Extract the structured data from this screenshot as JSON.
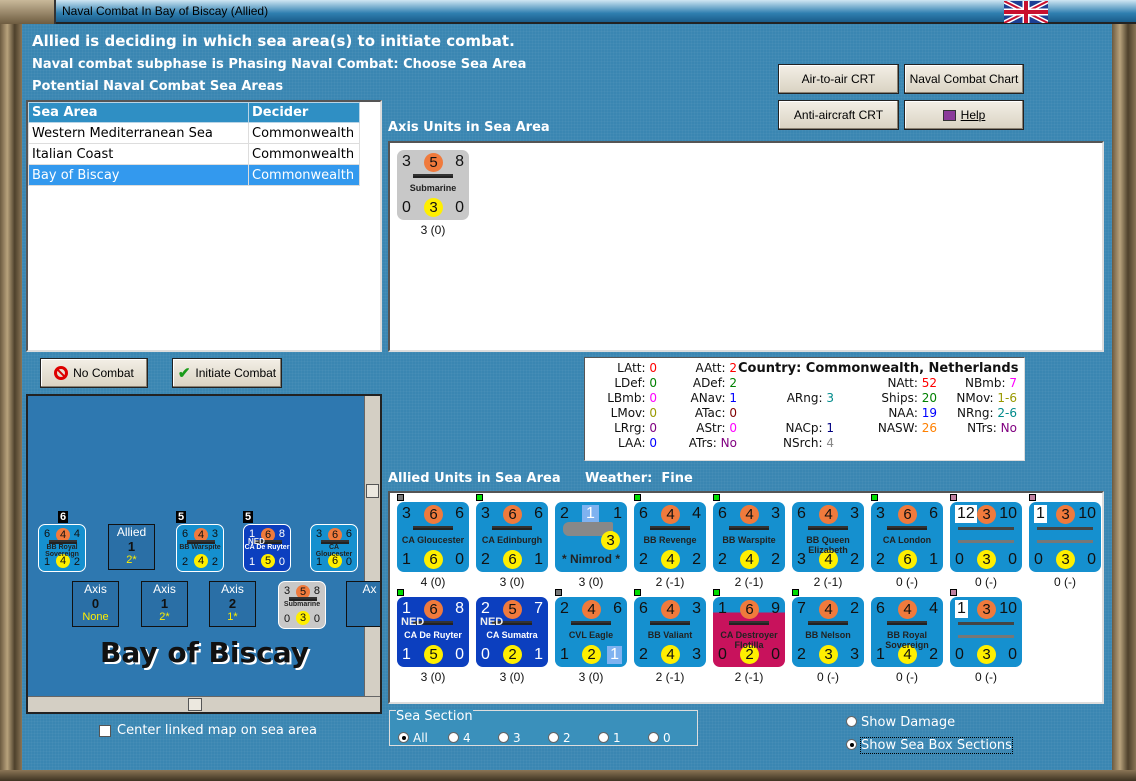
{
  "window": {
    "title": "Naval Combat In Bay of Biscay (Allied)"
  },
  "header": {
    "line1": "Allied is deciding in which sea area(s) to initiate combat.",
    "line2": "Naval combat subphase is Phasing Naval Combat: Choose Sea Area",
    "line3": "Potential Naval Combat Sea Areas"
  },
  "sea_table": {
    "columns": [
      "Sea Area",
      "Decider"
    ],
    "rows": [
      [
        "Western Mediterranean Sea",
        "Commonwealth"
      ],
      [
        "Italian Coast",
        "Commonwealth"
      ],
      [
        "Bay of Biscay",
        "Commonwealth"
      ]
    ],
    "selected": 2
  },
  "buttons": {
    "no_combat": "No Combat",
    "initiate_combat": "Initiate Combat",
    "air_to_air": "Air-to-air CRT",
    "naval_chart": "Naval Combat Chart",
    "anti_aircraft": "Anti-aircraft CRT",
    "help": "Help"
  },
  "axis": {
    "title": "Axis Units in Sea Area",
    "units": [
      {
        "tl": "3",
        "top": "5",
        "tr": "8",
        "name": "Submarine",
        "bl": "0",
        "bot": "3",
        "br": "0",
        "cap": "3 (0)",
        "style": "gray"
      }
    ]
  },
  "stats": {
    "country": "Country: Commonwealth, Netherlands",
    "items": [
      {
        "k": "LAtt:",
        "v": "0",
        "c": "#ff0000"
      },
      {
        "k": "LDef:",
        "v": "0",
        "c": "#008000"
      },
      {
        "k": "LBmb:",
        "v": "0",
        "c": "#ff00ff"
      },
      {
        "k": "LMov:",
        "v": "0",
        "c": "#999900"
      },
      {
        "k": "LRrg:",
        "v": "0",
        "c": "#800080"
      },
      {
        "k": "LAA:",
        "v": "0",
        "c": "#0000ff"
      },
      {
        "k": "AAtt:",
        "v": "2",
        "c": "#ff0000"
      },
      {
        "k": "ADef:",
        "v": "2",
        "c": "#008000"
      },
      {
        "k": "ANav:",
        "v": "1",
        "c": "#0000ff"
      },
      {
        "k": "ATac:",
        "v": "0",
        "c": "#800000"
      },
      {
        "k": "AStr:",
        "v": "0",
        "c": "#ff00ff"
      },
      {
        "k": "ATrs:",
        "v": "No",
        "c": "#800080"
      },
      {
        "k": "ARng:",
        "v": "3",
        "c": "#008b8b"
      },
      {
        "k": "NACp:",
        "v": "1",
        "c": "#000080"
      },
      {
        "k": "NSrch:",
        "v": "4",
        "c": "#888888"
      },
      {
        "k": "NAtt:",
        "v": "52",
        "c": "#ff0000"
      },
      {
        "k": "Ships:",
        "v": "20",
        "c": "#008000"
      },
      {
        "k": "NAA:",
        "v": "19",
        "c": "#0000ff"
      },
      {
        "k": "NASW:",
        "v": "26",
        "c": "#ff8000"
      },
      {
        "k": "NBmb:",
        "v": "7",
        "c": "#ff00ff"
      },
      {
        "k": "NMov:",
        "v": "1-6",
        "c": "#999900"
      },
      {
        "k": "NRng:",
        "v": "2-6",
        "c": "#008b8b"
      },
      {
        "k": "NTrs:",
        "v": "No",
        "c": "#800080"
      }
    ]
  },
  "allied": {
    "title": "Allied Units in Sea Area",
    "weather": "Weather:  Fine",
    "units": [
      {
        "tl": "3",
        "top": "6",
        "tr": "6",
        "name": "CA Gloucester",
        "bl": "1",
        "bot": "6",
        "br": "0",
        "cap": "4 (0)",
        "mk": "#777"
      },
      {
        "tl": "3",
        "top": "6",
        "tr": "6",
        "name": "CA Edinburgh",
        "bl": "2",
        "bot": "6",
        "br": "1",
        "cap": "3 (0)",
        "mk": "#00dd00"
      },
      {
        "tl": "2",
        "top": "1",
        "tr": "1",
        "name": "* Nimrod *",
        "bl": "",
        "bot": "3",
        "br": "",
        "cap": "3 (0)",
        "style": "air"
      },
      {
        "tl": "6",
        "top": "4",
        "tr": "4",
        "name": "BB Revenge",
        "bl": "2",
        "bot": "4",
        "br": "2",
        "cap": "2 (-1)",
        "mk": "#00dd00"
      },
      {
        "tl": "6",
        "top": "4",
        "tr": "3",
        "name": "BB Warspite",
        "bl": "2",
        "bot": "4",
        "br": "2",
        "cap": "2 (-1)",
        "mk": "#00dd00"
      },
      {
        "tl": "6",
        "top": "4",
        "tr": "3",
        "name": "BB Queen Elizabeth",
        "bl": "3",
        "bot": "4",
        "br": "2",
        "cap": "2 (-1)"
      },
      {
        "tl": "3",
        "top": "6",
        "tr": "6",
        "name": "CA London",
        "bl": "2",
        "bot": "6",
        "br": "1",
        "cap": "0 (-)",
        "mk": "#00dd00"
      },
      {
        "tl": "12",
        "top": "3",
        "tr": "10",
        "name": "",
        "bl": "0",
        "bot": "3",
        "br": "0",
        "cap": "0 (-)",
        "mk": "#c080a0",
        "style": "convoy"
      },
      {
        "tl": "1",
        "top": "3",
        "tr": "10",
        "name": "",
        "bl": "0",
        "bot": "3",
        "br": "0",
        "cap": "0 (-)",
        "mk": "#c080a0",
        "style": "convoy"
      },
      {
        "tl": "1",
        "top": "6",
        "tr": "8",
        "name": "CA De Ruyter",
        "bl": "1",
        "bot": "5",
        "br": "0",
        "cap": "3 (0)",
        "mk": "#00dd00",
        "style": "ned",
        "tag": "NED"
      },
      {
        "tl": "2",
        "top": "5",
        "tr": "7",
        "name": "CA Sumatra",
        "bl": "0",
        "bot": "2",
        "br": "1",
        "cap": "3 (0)",
        "style": "ned",
        "tag": "NED"
      },
      {
        "tl": "2",
        "top": "4",
        "tr": "6",
        "name": "CVL Eagle",
        "bl": "1",
        "bot": "2",
        "br": "1",
        "cap": "3 (0)",
        "mk": "#777",
        "style": "carrier"
      },
      {
        "tl": "6",
        "top": "4",
        "tr": "3",
        "name": "BB Valiant",
        "bl": "2",
        "bot": "4",
        "br": "3",
        "cap": "2 (-1)",
        "mk": "#00dd00"
      },
      {
        "tl": "1",
        "top": "6",
        "tr": "9",
        "name": "CA Destroyer Flotilla",
        "bl": "0",
        "bot": "2",
        "br": "0",
        "cap": "2 (-1)",
        "mk": "#00dd00",
        "style": "pink"
      },
      {
        "tl": "7",
        "top": "4",
        "tr": "2",
        "name": "BB Nelson",
        "bl": "2",
        "bot": "3",
        "br": "3",
        "cap": "0 (-)",
        "mk": "#00dd00"
      },
      {
        "tl": "6",
        "top": "4",
        "tr": "4",
        "name": "BB Royal Sovereign",
        "bl": "1",
        "bot": "4",
        "br": "2",
        "cap": "0 (-)"
      },
      {
        "tl": "1",
        "top": "3",
        "tr": "10",
        "name": "",
        "bl": "0",
        "bot": "3",
        "br": "0",
        "cap": "0 (-)",
        "mk": "#c080a0",
        "style": "convoy"
      }
    ]
  },
  "map": {
    "sea_name": "Bay of Biscay",
    "allied_box": {
      "title": "Allied",
      "num": "1",
      "val": "2*"
    },
    "axis_boxes": [
      {
        "title": "Axis",
        "num": "0",
        "val": "None"
      },
      {
        "title": "Axis",
        "num": "1",
        "val": "2*"
      },
      {
        "title": "Axis",
        "num": "2",
        "val": "1*"
      },
      {
        "title": "Ax",
        "num": "",
        "val": ""
      }
    ],
    "stack_counts": [
      "6",
      "5",
      "5"
    ],
    "counters": [
      {
        "tl": "6",
        "top": "4",
        "tr": "4",
        "name": "BB Royal Sovereign",
        "bl": "1",
        "bot": "4",
        "br": "2"
      },
      {
        "tl": "6",
        "top": "4",
        "tr": "3",
        "name": "BB Warspite",
        "bl": "2",
        "bot": "4",
        "br": "2"
      },
      {
        "tl": "1",
        "top": "6",
        "tr": "8",
        "name": "CA De Ruyter",
        "bl": "1",
        "bot": "5",
        "br": "0",
        "style": "ned",
        "tag": "NED"
      },
      {
        "tl": "3",
        "top": "6",
        "tr": "6",
        "name": "CA Gloucester",
        "bl": "1",
        "bot": "6",
        "br": "0"
      },
      {
        "tl": "3",
        "top": "5",
        "tr": "8",
        "name": "Submarine",
        "bl": "0",
        "bot": "3",
        "br": "0",
        "style": "gray"
      }
    ]
  },
  "center_map": {
    "label": "Center linked map on sea area",
    "checked": false
  },
  "sea_section": {
    "label": "Sea Section",
    "options": [
      "All",
      "4",
      "3",
      "2",
      "1",
      "0"
    ],
    "selected": "All"
  },
  "view_options": {
    "options": [
      "Show Damage",
      "Show Sea Box Sections"
    ],
    "selected": "Show Sea Box Sections"
  }
}
